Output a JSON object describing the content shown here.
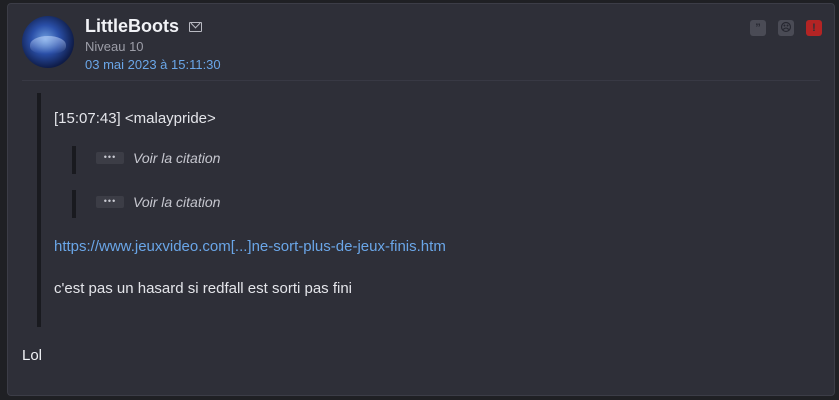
{
  "post": {
    "username": "LittleBoots",
    "level": "Niveau 10",
    "date": "03 mai 2023 à 15:11:30",
    "actions": [
      {
        "name": "quote-icon",
        "glyph": "”"
      },
      {
        "name": "blacklist-icon",
        "glyph": "☹"
      },
      {
        "name": "report-icon",
        "glyph": "!"
      }
    ],
    "quote": {
      "header": "[15:07:43] <malaypride>",
      "nested": [
        {
          "ellipsis": "•••",
          "label": "Voir la citation"
        },
        {
          "ellipsis": "•••",
          "label": "Voir la citation"
        }
      ],
      "link": "https://www.jeuxvideo.com[...]ne-sort-plus-de-jeux-finis.htm",
      "text": "c'est pas un hasard si redfall est sorti pas fini"
    },
    "reply": "Lol"
  },
  "colors": {
    "background": "#2e2f38",
    "link": "#6aa6e8",
    "alert": "#b32424"
  }
}
